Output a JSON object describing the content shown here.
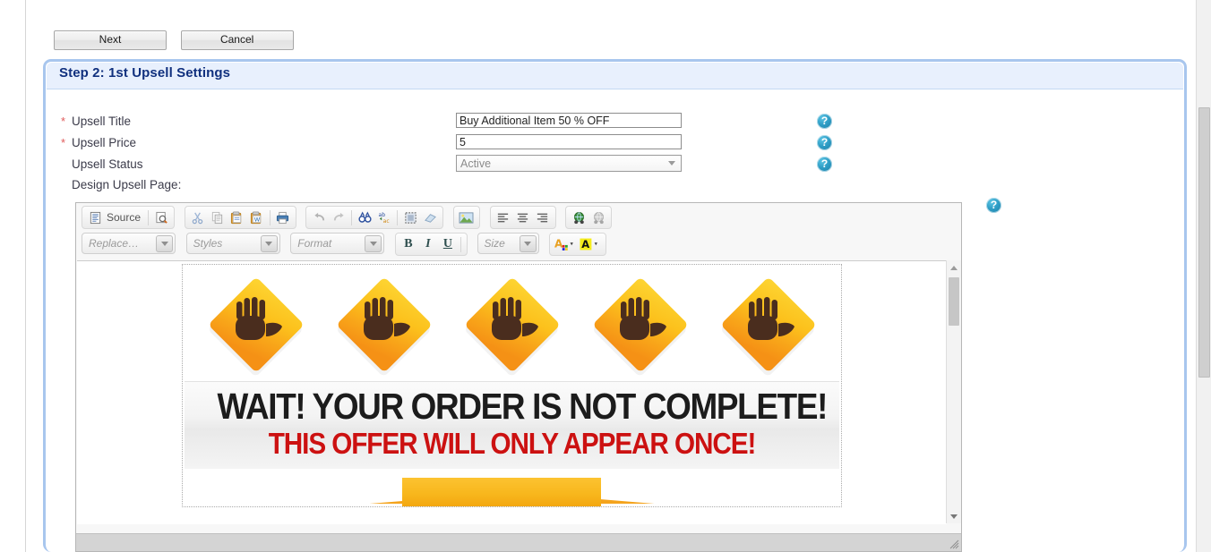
{
  "toolbar_buttons": {
    "next": "Next",
    "cancel": "Cancel"
  },
  "panel": {
    "title": "Step 2: 1st Upsell Settings"
  },
  "form": {
    "rows": [
      {
        "label": "Upsell Title",
        "required": true,
        "value": "Buy Additional Item 50 % OFF",
        "help": "?"
      },
      {
        "label": "Upsell Price",
        "required": true,
        "value": "5",
        "help": "?"
      },
      {
        "label": "Upsell Status",
        "required": false,
        "value": "Active",
        "help": "?"
      }
    ],
    "design_label": "Design Upsell Page:",
    "design_help": "?",
    "required_marker": "*"
  },
  "editor": {
    "toolbar_row1": [
      {
        "name": "source-button",
        "label": "Source",
        "icon": "source-icon"
      },
      {
        "name": "preview-button",
        "label": "",
        "icon": "preview-icon"
      },
      {
        "name": "cut-button",
        "label": "",
        "icon": "cut-icon"
      },
      {
        "name": "copy-button",
        "label": "",
        "icon": "copy-icon"
      },
      {
        "name": "paste-button",
        "label": "",
        "icon": "paste-icon"
      },
      {
        "name": "paste-from-word-button",
        "label": "",
        "icon": "paste-word-icon"
      },
      {
        "name": "print-button",
        "label": "",
        "icon": "print-icon"
      },
      {
        "name": "undo-button",
        "label": "",
        "icon": "undo-icon"
      },
      {
        "name": "redo-button",
        "label": "",
        "icon": "redo-icon"
      },
      {
        "name": "find-button",
        "label": "",
        "icon": "find-icon"
      },
      {
        "name": "replace-button",
        "label": "",
        "icon": "replace-icon"
      },
      {
        "name": "select-all-button",
        "label": "",
        "icon": "select-all-icon"
      },
      {
        "name": "remove-format-button",
        "label": "",
        "icon": "remove-format-icon"
      },
      {
        "name": "image-button",
        "label": "",
        "icon": "image-icon"
      },
      {
        "name": "align-left-button",
        "label": "",
        "icon": "align-left-icon"
      },
      {
        "name": "align-center-button",
        "label": "",
        "icon": "align-center-icon"
      },
      {
        "name": "align-right-button",
        "label": "",
        "icon": "align-right-icon"
      },
      {
        "name": "link-button",
        "label": "",
        "icon": "link-icon"
      },
      {
        "name": "unlink-button",
        "label": "",
        "icon": "unlink-icon"
      }
    ],
    "combos": [
      {
        "name": "replace-combo",
        "label": "Replace…"
      },
      {
        "name": "styles-combo",
        "label": "Styles"
      },
      {
        "name": "format-combo",
        "label": "Format"
      },
      {
        "name": "size-combo",
        "label": "Size"
      }
    ],
    "format_buttons": [
      {
        "name": "bold-button",
        "label": "B"
      },
      {
        "name": "italic-button",
        "label": "I"
      },
      {
        "name": "underline-button",
        "label": "U"
      }
    ],
    "color_buttons": [
      {
        "name": "text-color-button",
        "label": "A"
      },
      {
        "name": "background-color-button",
        "label": "A"
      }
    ],
    "content": {
      "icon_count": 5,
      "icon_name": "stop-hand-warning-icon",
      "headline": "WAIT! YOUR ORDER IS NOT COMPLETE!",
      "subheadline": "THIS OFFER WILL ONLY APPEAR ONCE!"
    }
  },
  "colors": {
    "panel_border": "#a8c6ee",
    "panel_header_bg": "#e8f0fd",
    "panel_title": "#10307e",
    "required_star": "#e05b5b",
    "help_icon": "#2f9ec6",
    "headline": "#1c1c1c",
    "subheadline": "#cc1111",
    "warning_diamond": "#f9b919",
    "warning_hand": "#4a2d1e",
    "ribbon": "#f8b71d"
  }
}
